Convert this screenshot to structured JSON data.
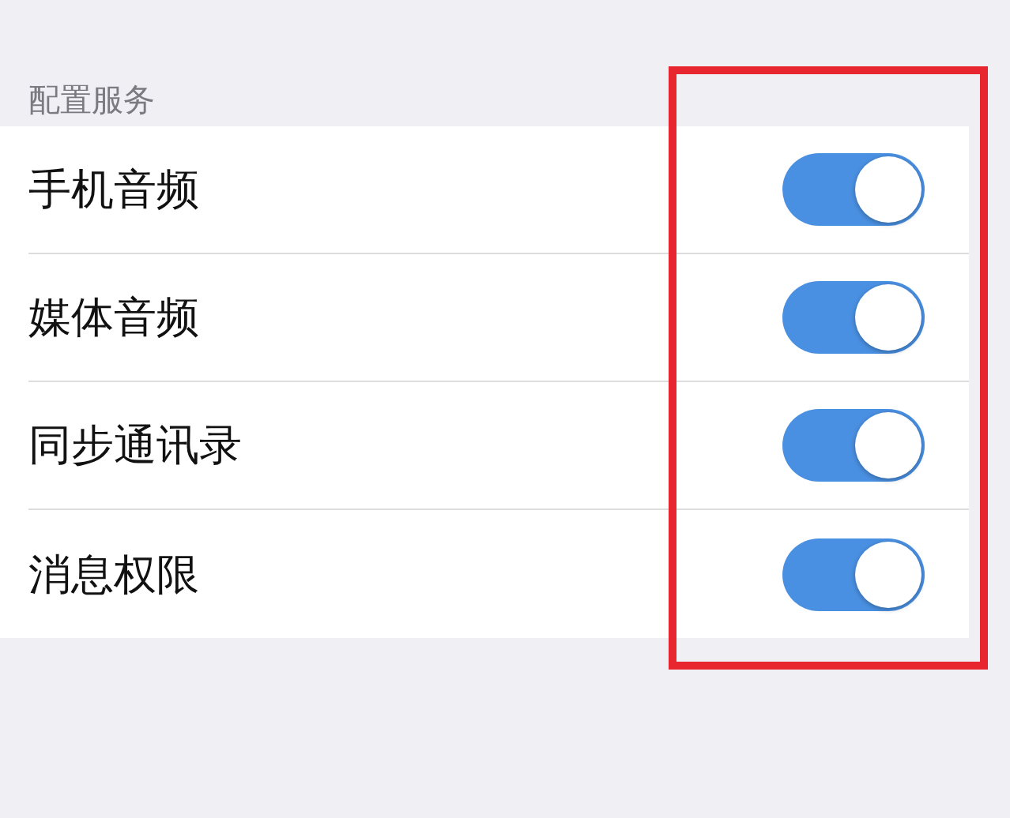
{
  "section": {
    "title": "配置服务"
  },
  "items": [
    {
      "label": "手机音频",
      "on": true
    },
    {
      "label": "媒体音频",
      "on": true
    },
    {
      "label": "同步通讯录",
      "on": true
    },
    {
      "label": "消息权限",
      "on": true
    }
  ]
}
